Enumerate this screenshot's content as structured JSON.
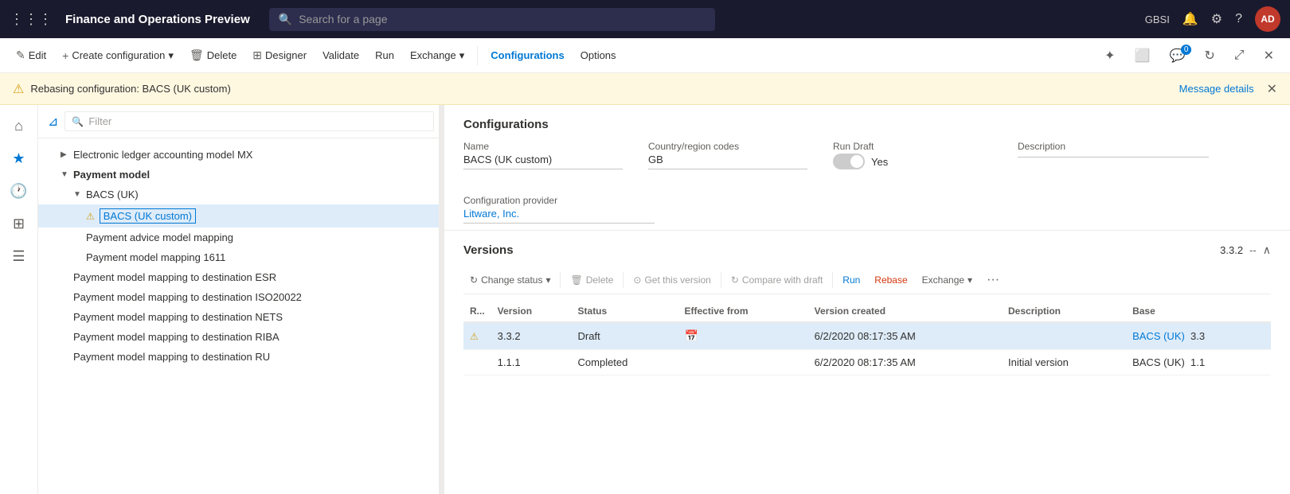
{
  "app": {
    "title": "Finance and Operations Preview",
    "grid_icon": "⊞",
    "search_placeholder": "Search for a page"
  },
  "topnav": {
    "user_initials": "AD",
    "user_org": "GBSI",
    "notification_icon": "🔔",
    "settings_icon": "⚙",
    "help_icon": "?"
  },
  "toolbar": {
    "edit_label": "Edit",
    "create_label": "Create configuration",
    "delete_label": "Delete",
    "designer_label": "Designer",
    "validate_label": "Validate",
    "run_label": "Run",
    "exchange_label": "Exchange",
    "configurations_label": "Configurations",
    "options_label": "Options"
  },
  "warning": {
    "text": "Rebasing configuration: BACS (UK custom)",
    "link": "Message details"
  },
  "filter": {
    "placeholder": "Filter"
  },
  "tree": {
    "items": [
      {
        "label": "Electronic ledger accounting model MX",
        "indent": 1,
        "expandable": true,
        "expanded": false
      },
      {
        "label": "Payment model",
        "indent": 1,
        "expandable": true,
        "expanded": true,
        "bold": true
      },
      {
        "label": "BACS (UK)",
        "indent": 2,
        "expandable": true,
        "expanded": true
      },
      {
        "label": "BACS (UK custom)",
        "indent": 3,
        "selected": true,
        "warn": true
      },
      {
        "label": "Payment advice model mapping",
        "indent": 2
      },
      {
        "label": "Payment model mapping 1611",
        "indent": 2
      },
      {
        "label": "Payment model mapping to destination ESR",
        "indent": 2
      },
      {
        "label": "Payment model mapping to destination ISO20022",
        "indent": 2
      },
      {
        "label": "Payment model mapping to destination NETS",
        "indent": 2
      },
      {
        "label": "Payment model mapping to destination RIBA",
        "indent": 2
      },
      {
        "label": "Payment model mapping to destination RU",
        "indent": 2
      }
    ]
  },
  "config": {
    "section_title": "Configurations",
    "name_label": "Name",
    "name_value": "BACS (UK custom)",
    "country_label": "Country/region codes",
    "country_value": "GB",
    "run_draft_label": "Run Draft",
    "run_draft_toggle": "Yes",
    "description_label": "Description",
    "description_value": "",
    "config_provider_label": "Configuration provider",
    "config_provider_value": "Litware, Inc."
  },
  "versions": {
    "section_title": "Versions",
    "current_version": "3.3.2",
    "dash": "--",
    "toolbar": {
      "change_status_label": "Change status",
      "delete_label": "Delete",
      "get_this_version_label": "Get this version",
      "compare_with_draft_label": "Compare with draft",
      "run_label": "Run",
      "rebase_label": "Rebase",
      "exchange_label": "Exchange",
      "more_label": "···"
    },
    "table": {
      "headers": [
        "R...",
        "Version",
        "Status",
        "Effective from",
        "Version created",
        "Description",
        "Base"
      ],
      "rows": [
        {
          "warn": true,
          "version": "3.3.2",
          "status": "Draft",
          "effective_from": "",
          "has_calendar": true,
          "version_created": "6/2/2020 08:17:35 AM",
          "description": "",
          "base": "BACS (UK)",
          "base_version": "3.3",
          "selected": true
        },
        {
          "warn": false,
          "version": "1.1.1",
          "status": "Completed",
          "effective_from": "",
          "has_calendar": false,
          "version_created": "6/2/2020 08:17:35 AM",
          "description": "Initial version",
          "base": "BACS (UK)",
          "base_version": "1.1",
          "selected": false
        }
      ]
    }
  }
}
